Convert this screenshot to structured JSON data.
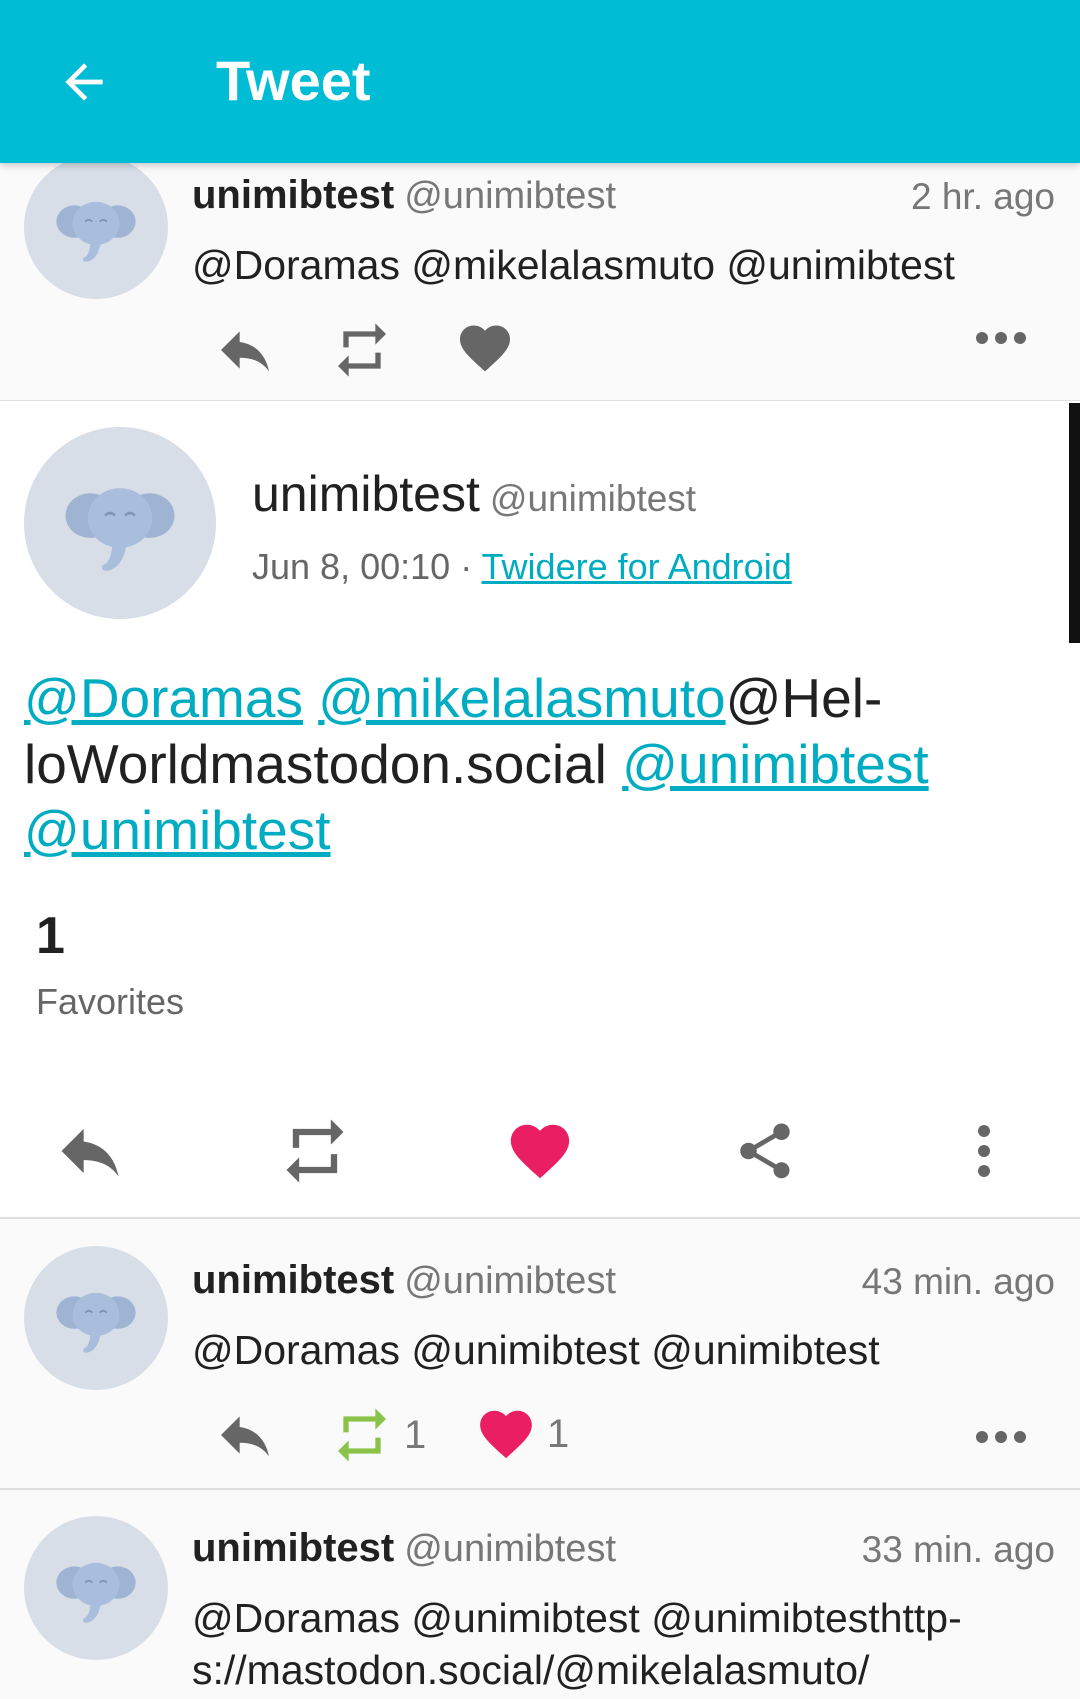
{
  "appbar": {
    "title": "Tweet"
  },
  "colors": {
    "accent": "#00bcd4",
    "link": "#00acc1",
    "favorite": "#e91e63",
    "retweet": "#8bc34a"
  },
  "top_row": {
    "name": "unimibtest",
    "handle": "@unimibtest",
    "time": "2 hr. ago",
    "text": "@Doramas @mikelalasmuto @unimibtest"
  },
  "detail": {
    "name": "unimibtest",
    "handle": "@unimibtest",
    "date": "Jun 8, 00:10",
    "separator": "·",
    "source": "Twidere for Android",
    "body": {
      "m1": "@Doramas",
      "m2": "@mikelalasmuto",
      "plain1": "@Hel-",
      "plain2": "loWorldmastodon.social",
      "m3": "@unimibtest",
      "m4": "@unimibtest"
    },
    "favorites_count": "1",
    "favorites_label": "Favorites"
  },
  "reply_1": {
    "name": "unimibtest",
    "handle": "@unimibtest",
    "time": "43 min. ago",
    "text": "@Doramas @unimibtest @unimibtest",
    "retweet_count": "1",
    "favorite_count": "1"
  },
  "reply_2": {
    "name": "unimibtest",
    "handle": "@unimibtest",
    "time": "33 min. ago",
    "text_line1": "@Doramas @unimibtest @unimibtesthttp-",
    "text_line2": "s://mastodon.social/@mikelalasmuto/"
  }
}
